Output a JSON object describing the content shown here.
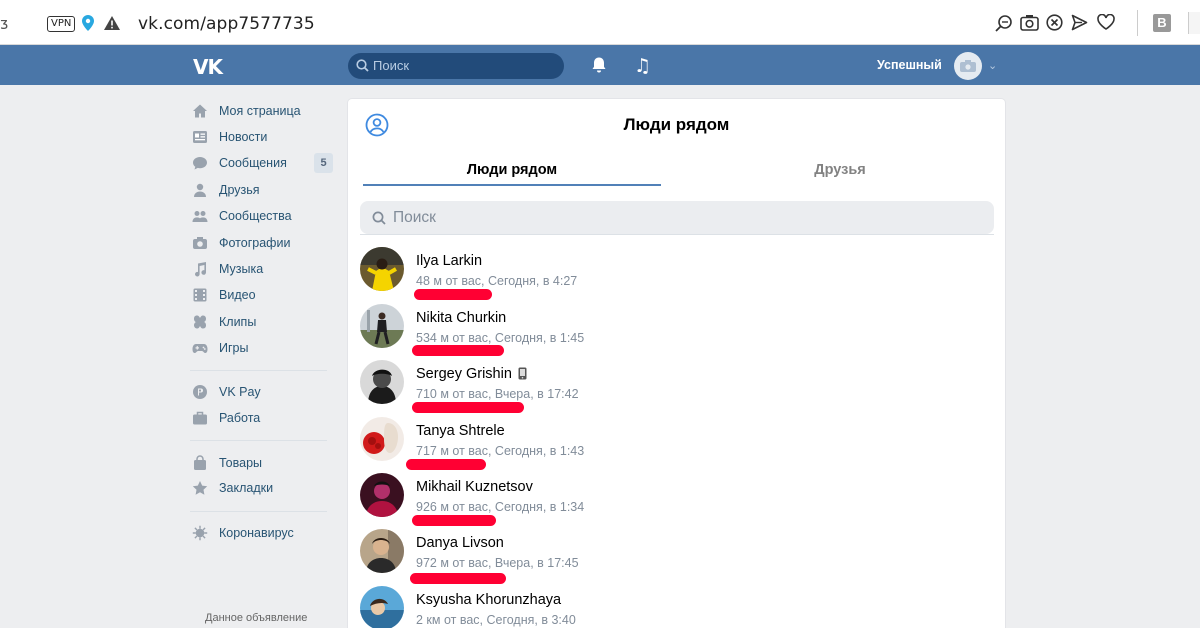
{
  "browser": {
    "url": "vk.com/app7577735",
    "vpn_label": "VPN",
    "extension_letter": "B"
  },
  "header": {
    "logo": "VK",
    "search_placeholder": "Поиск",
    "username": "Успешный",
    "accent_color": "#4a76a8"
  },
  "sidebar": {
    "items": [
      {
        "label": "Моя страница",
        "icon": "home-icon"
      },
      {
        "label": "Новости",
        "icon": "news-icon"
      },
      {
        "label": "Сообщения",
        "icon": "messages-icon",
        "badge": "5"
      },
      {
        "label": "Друзья",
        "icon": "friends-icon"
      },
      {
        "label": "Сообщества",
        "icon": "communities-icon"
      },
      {
        "label": "Фотографии",
        "icon": "camera-icon"
      },
      {
        "label": "Музыка",
        "icon": "music-icon"
      },
      {
        "label": "Видео",
        "icon": "video-icon"
      },
      {
        "label": "Клипы",
        "icon": "clips-icon"
      },
      {
        "label": "Игры",
        "icon": "gamepad-icon"
      },
      {
        "label": "VK Pay",
        "icon": "vkpay-icon"
      },
      {
        "label": "Работа",
        "icon": "briefcase-icon"
      },
      {
        "label": "Товары",
        "icon": "shopping-bag-icon"
      },
      {
        "label": "Закладки",
        "icon": "star-icon"
      },
      {
        "label": "Коронавирус",
        "icon": "virus-icon"
      }
    ],
    "ad_label": "Данное объявление"
  },
  "main": {
    "title": "Люди рядом",
    "tabs": [
      {
        "label": "Люди рядом",
        "active": true
      },
      {
        "label": "Друзья",
        "active": false
      }
    ],
    "search_placeholder": "Поиск",
    "people": [
      {
        "name": "Ilya Larkin",
        "meta": "48 м от вас, Сегодня, в 4:27"
      },
      {
        "name": "Nikita Churkin",
        "meta": "534 м от вас, Сегодня, в 1:45"
      },
      {
        "name": "Sergey Grishin",
        "meta": "710 м от вас, Вчера, в 17:42",
        "mobile": true
      },
      {
        "name": "Tanya Shtrele",
        "meta": "717 м от вас, Сегодня, в 1:43"
      },
      {
        "name": "Mikhail Kuznetsov",
        "meta": "926 м от вас, Сегодня, в 1:34"
      },
      {
        "name": "Danya Livson",
        "meta": "972 м от вас, Вчера, в 17:45"
      },
      {
        "name": "Ksyusha Khorunzhaya",
        "meta": "2 км от вас, Сегодня, в 3:40"
      }
    ]
  }
}
